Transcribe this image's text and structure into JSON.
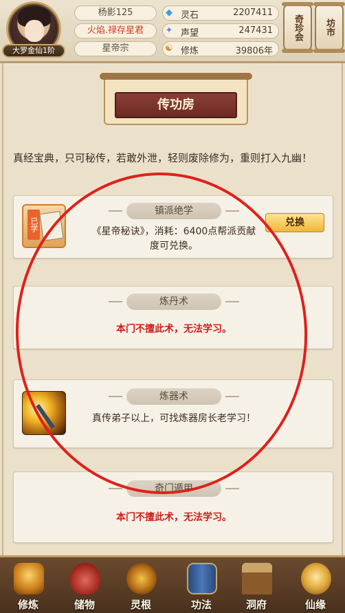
{
  "player": {
    "name": "杨影125",
    "title": "火焰.禄存星君",
    "sect": "星帝宗",
    "rank": "大罗金仙1阶"
  },
  "resources": [
    {
      "label": "灵石",
      "value": "2207411",
      "icon": "spirit-stone-icon",
      "color": "#3d9ce0",
      "glyph": "◆"
    },
    {
      "label": "声望",
      "value": "247431",
      "icon": "reputation-icon",
      "color": "#6a7ee0",
      "glyph": "✦"
    },
    {
      "label": "修炼",
      "value": "39806年",
      "icon": "cultivation-icon",
      "color": "#d58a2a",
      "glyph": "☯"
    }
  ],
  "top_buttons": {
    "treasure": "奇珍会",
    "market": "坊市"
  },
  "page": {
    "title": "传功房",
    "intro": "真经宝典，只可秘传，若敢外泄，轻则废除修为，重则打入九幽！"
  },
  "skills": [
    {
      "title": "镇派绝学",
      "desc": "《星帝秘诀》，消耗：6400点帮派贡献度可兑换。",
      "badge": "已学",
      "action": "兑换"
    },
    {
      "title": "炼丹术",
      "desc": "本门不擅此术，无法学习。"
    },
    {
      "title": "炼器术",
      "desc": "真传弟子以上，可找炼器房长老学习！"
    },
    {
      "title": "奇门遁甲",
      "desc": "本门不擅此术，无法学习。"
    }
  ],
  "nav": [
    {
      "label": "修炼",
      "icon": "cultivate-icon"
    },
    {
      "label": "储物",
      "icon": "storage-bag-icon"
    },
    {
      "label": "灵根",
      "icon": "spirit-root-icon"
    },
    {
      "label": "功法",
      "icon": "technique-book-icon"
    },
    {
      "label": "洞府",
      "icon": "cave-house-icon"
    },
    {
      "label": "仙缘",
      "icon": "fate-icon"
    }
  ]
}
